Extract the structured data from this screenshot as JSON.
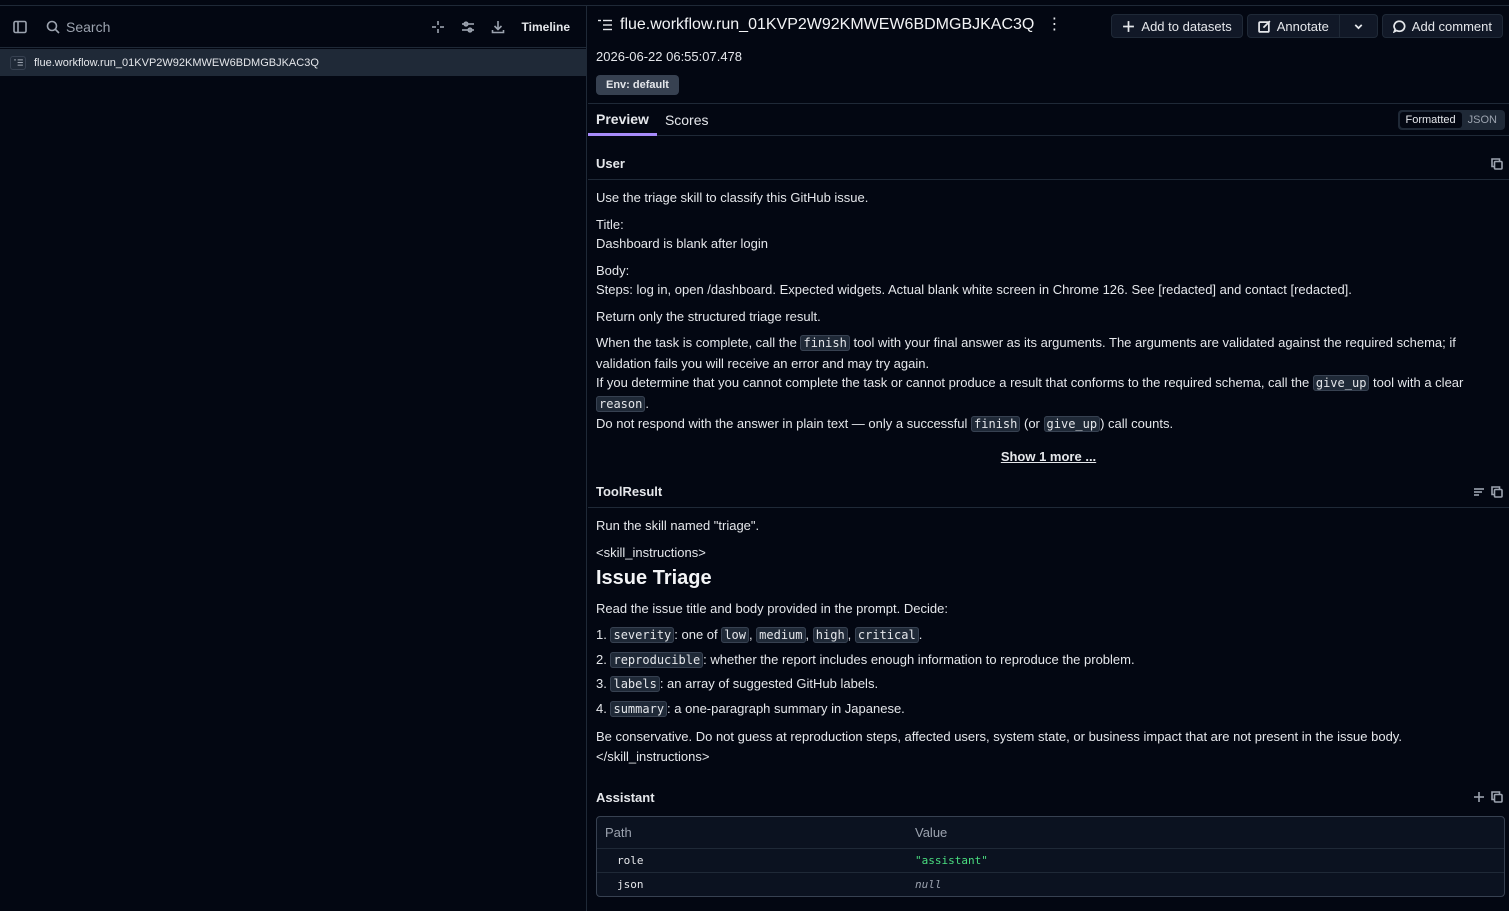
{
  "left": {
    "search_placeholder": "Search",
    "timeline_label": "Timeline",
    "tree": [
      {
        "label": "flue.workflow.run_01KVP2W92KMWEW6BDMGBJKAC3Q"
      }
    ]
  },
  "header": {
    "title": "flue.workflow.run_01KVP2W92KMWEW6BDMGBJKAC3Q",
    "timestamp": "2026-06-22 06:55:07.478",
    "env_badge": "Env: default",
    "add_datasets": "Add to datasets",
    "annotate": "Annotate",
    "add_comment": "Add comment"
  },
  "tabs": {
    "preview": "Preview",
    "scores": "Scores",
    "formatted": "Formatted",
    "json": "JSON"
  },
  "user": {
    "heading": "User",
    "p1": "Use the triage skill to classify this GitHub issue.",
    "title_label": "Title:",
    "title_value": "Dashboard is blank after login",
    "body_label": "Body:",
    "body_value": "Steps: log in, open /dashboard. Expected widgets. Actual blank white screen in Chrome 126. See [redacted] and contact [redacted].",
    "p_return": "Return only the structured triage result.",
    "i1a": "When the task is complete, call the ",
    "code_finish": "finish",
    "i1b": " tool with your final answer as its arguments. The arguments are validated against the required schema; if validation fails you will receive an error and may try again.",
    "i2a": "If you determine that you cannot complete the task or cannot produce a result that conforms to the required schema, call the ",
    "code_give_up": "give_up",
    "i2b": " tool with a clear ",
    "code_reason": "reason",
    "i2c": ".",
    "i3a": "Do not respond with the answer in plain text — only a successful ",
    "i3b": " (or ",
    "i3c": ") call counts.",
    "show_more": "Show 1 more ..."
  },
  "tool": {
    "heading": "ToolResult",
    "p1": "Run the skill named \"triage\".",
    "open_tag": "<skill_instructions>",
    "h2": "Issue Triage",
    "intro": "Read the issue title and body provided in the prompt. Decide:",
    "items": [
      {
        "num": "1.",
        "code": "severity",
        "text": ": one of "
      },
      {
        "num": "2.",
        "code": "reproducible",
        "text": ": whether the report includes enough information to reproduce the problem."
      },
      {
        "num": "3.",
        "code": "labels",
        "text": ": an array of suggested GitHub labels."
      },
      {
        "num": "4.",
        "code": "summary",
        "text": ": a one-paragraph summary in Japanese."
      }
    ],
    "severity_opts": [
      "low",
      "medium",
      "high",
      "critical"
    ],
    "conservative": "Be conservative. Do not guess at reproduction steps, affected users, system state, or business impact that are not present in the issue body.",
    "close_tag": "</skill_instructions>"
  },
  "assistant": {
    "heading": "Assistant",
    "col_path": "Path",
    "col_value": "Value",
    "rows": [
      {
        "path": "role",
        "value": "\"assistant\""
      },
      {
        "path": "json",
        "value": "null"
      }
    ]
  }
}
